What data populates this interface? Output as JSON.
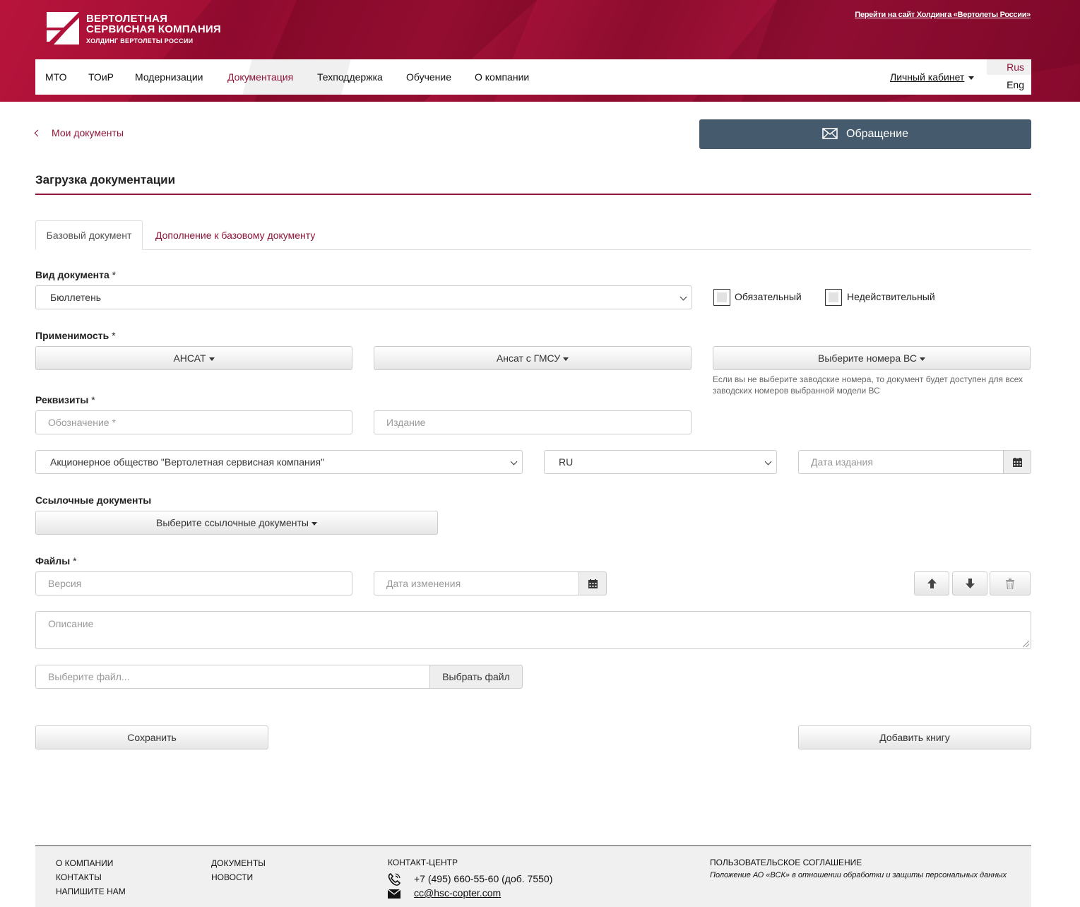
{
  "header": {
    "logo_line1": "ВЕРТОЛЕТНАЯ",
    "logo_line2": "СЕРВИСНАЯ КОМПАНИЯ",
    "logo_line3": "ХОЛДИНГ ВЕРТОЛЕТЫ РОССИИ",
    "holding_link": "Перейти на сайт Холдинга «Вертолеты России»",
    "brand_color": "#8e1537"
  },
  "nav": {
    "items": [
      {
        "label": "МТО"
      },
      {
        "label": "ТОиР"
      },
      {
        "label": "Модернизации"
      },
      {
        "label": "Документация",
        "active": true
      },
      {
        "label": "Техподдержка"
      },
      {
        "label": "Обучение"
      },
      {
        "label": "О компании"
      }
    ],
    "cabinet": "Личный кабинет",
    "lang_rus": "Rus",
    "lang_eng": "Eng"
  },
  "page": {
    "back_link": "Мои документы",
    "appeal_button": "Обращение",
    "title": "Загрузка документации",
    "tabs": [
      {
        "label": "Базовый документ",
        "active": true
      },
      {
        "label": "Дополнение к базовому документу"
      }
    ]
  },
  "form": {
    "doc_type_label": "Вид документа",
    "doc_type_value": "Бюллетень",
    "required_mark": "*",
    "mandatory_label": "Обязательный",
    "invalid_label": "Недействительный",
    "applicability_label": "Применимость",
    "model_1": "АНСАТ",
    "model_2": "Ансат с ГМСУ",
    "serials_button": "Выберите номера ВС",
    "serials_hint": "Если вы не выберите заводские номера, то документ будет доступен для всех заводских номеров выбранной модели ВС",
    "requisites_label": "Реквизиты",
    "designation_placeholder": "Обозначение *",
    "edition_placeholder": "Издание",
    "organization_value": "Акционерное общество \"Вертолетная сервисная компания\"",
    "language_value": "RU",
    "edition_date_placeholder": "Дата издания",
    "ref_docs_label": "Ссылочные документы",
    "ref_docs_button": "Выберите ссылочные документы",
    "files_label": "Файлы",
    "version_placeholder": "Версия",
    "change_date_placeholder": "Дата изменения",
    "description_placeholder": "Описание",
    "file_placeholder": "Выберите файл...",
    "file_button": "Выбрать файл",
    "save_button": "Сохранить",
    "add_book_button": "Добавить книгу"
  },
  "footer": {
    "col1": [
      "О КОМПАНИИ",
      "КОНТАКТЫ",
      "НАПИШИТЕ НАМ"
    ],
    "col2": [
      "ДОКУМЕНТЫ",
      "НОВОСТИ"
    ],
    "contact_head": "КОНТАКТ-ЦЕНТР",
    "phone": "+7 (495) 660-55-60 (доб. 7550)",
    "email": "cc@hsc-copter.com",
    "agreement": "ПОЛЬЗОВАТЕЛЬСКОЕ СОГЛАШЕНИЕ",
    "policy": "Положение АО «ВСК» в отношении обработки и защиты персональных данных"
  }
}
